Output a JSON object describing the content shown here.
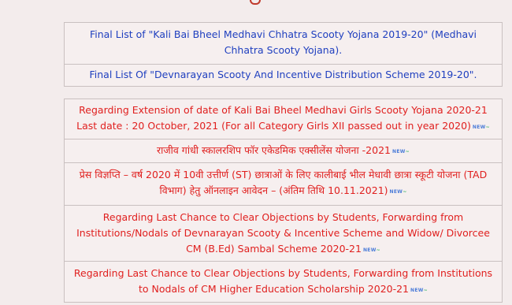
{
  "badge": {
    "text": "NEW"
  },
  "group1": [
    {
      "text": "Final List of \"Kali Bai Bheel Medhavi Chhatra Scooty Yojana 2019-20\" (Medhavi Chhatra Scooty Yojana)."
    },
    {
      "text": "Final List Of \"Devnarayan Scooty And Incentive Distribution Scheme 2019-20\"."
    }
  ],
  "group2": [
    {
      "text": "Regarding Extension of date of Kali Bai Bheel Medhavi Girls Scooty Yojana 2020-21 Last date : 20 October, 2021 (For all Category Girls XII passed out in year 2020)"
    },
    {
      "text": "राजीव गांधी स्कालरशिप फॉर एकेडमिक एक्सीलेंस योजना -2021"
    },
    {
      "text": "प्रेस विज्ञप्ति – वर्ष 2020 में 10वी उत्तीर्ण (ST) छात्राओं के लिए कालीबाई भील मेधावी छात्रा स्कूटी योजना (TAD विभाग) हेतु ऑनलाइन आवेदन – (अंतिम तिथि 10.11.2021)"
    },
    {
      "text": "Regarding Last Chance to Clear Objections by Students, Forwarding from Institutions/Nodals of Devnarayan Scooty & Incentive Scheme and Widow/ Divorcee CM (B.Ed) Sambal Scheme 2020-21"
    },
    {
      "text": "Regarding Last Chance to Clear Objections by Students, Forwarding from Institutions to Nodals of CM Higher Education Scholarship 2020-21"
    }
  ]
}
